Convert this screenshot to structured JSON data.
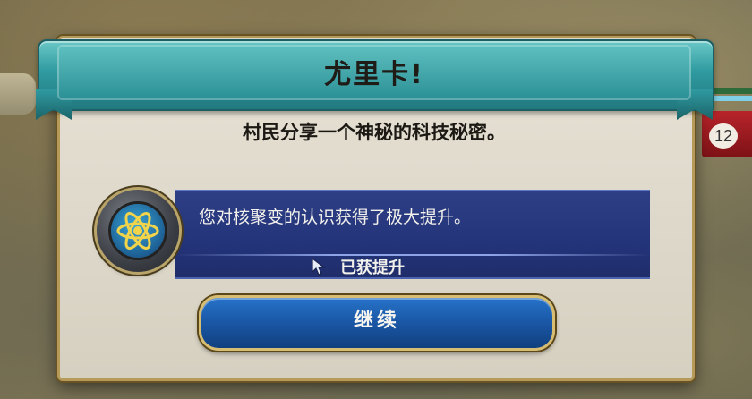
{
  "dialog": {
    "title": "尤里卡!",
    "message": "村民分享一个神秘的科技秘密。",
    "info_text": "您对核聚变的认识获得了极大提升。",
    "boost_label": "已获提升",
    "tech_icon": "atom-icon",
    "continue_label": "继续"
  },
  "hud": {
    "city_number": "12"
  },
  "colors": {
    "banner": "#2f9aa0",
    "panel": "#24347a",
    "button": "#1b59a8",
    "gold_border": "#d7bd72"
  }
}
